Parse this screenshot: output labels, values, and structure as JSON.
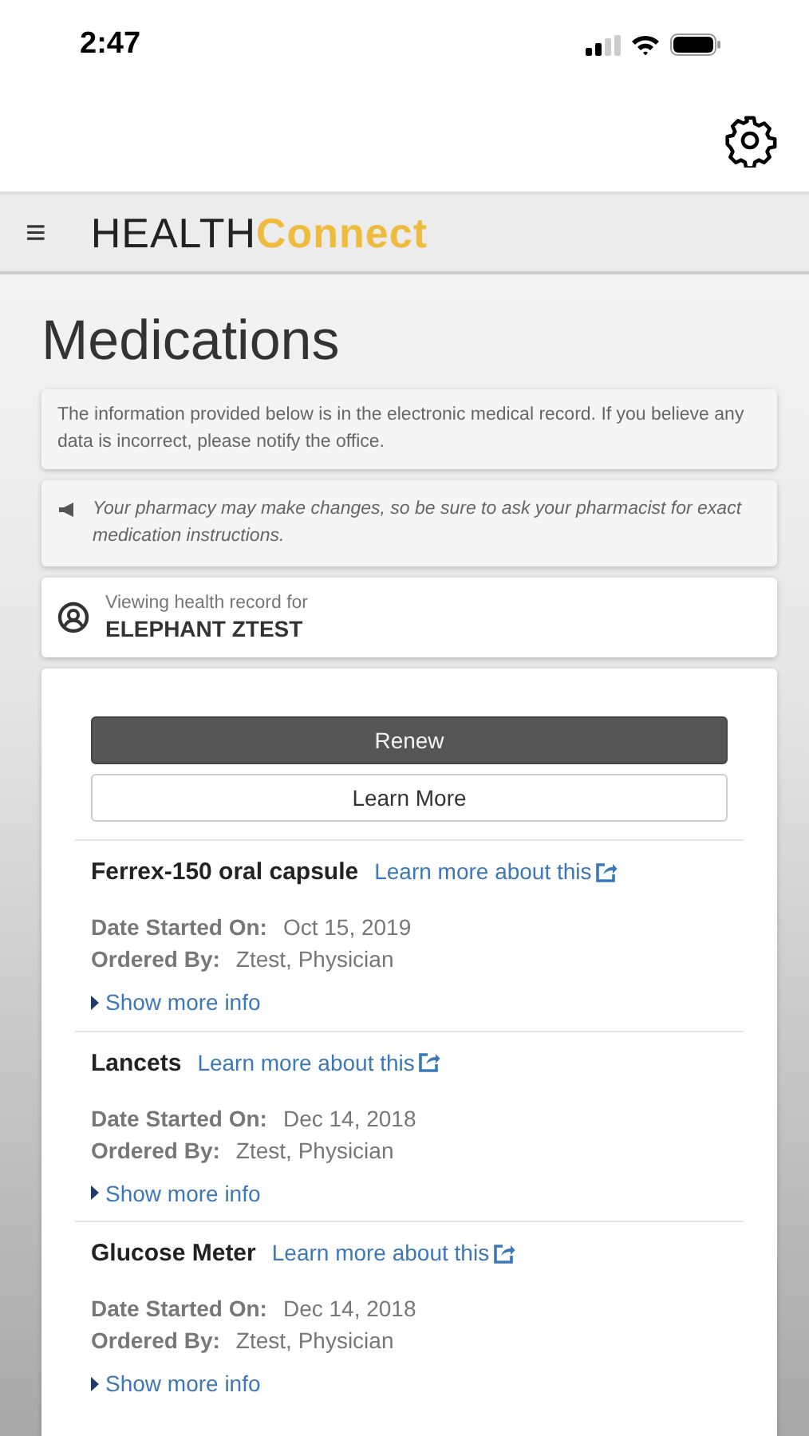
{
  "status_bar": {
    "time": "2:47"
  },
  "header": {
    "menu_glyph": "≡",
    "logo_dark": "HEALTH",
    "logo_accent": "Connect"
  },
  "page": {
    "title": "Medications",
    "notice": "The information provided below is in the electronic medical record. If you believe any data is incorrect, please notify the office.",
    "pharmacy_note": "Your pharmacy may make changes, so be sure to ask your pharmacist for exact medication instructions.",
    "record_label": "Viewing health record for",
    "patient_name": "ELEPHANT ZTEST"
  },
  "buttons": [
    {
      "label": "Renew",
      "kind": "primary"
    },
    {
      "label": "Learn More",
      "kind": "secondary"
    }
  ],
  "medications": [
    {
      "name": "Ferrex-150 oral capsule",
      "link": "Learn more about this",
      "fields": [
        {
          "label": "Date Started On:",
          "value": "Oct 15, 2019"
        },
        {
          "label": "Ordered By:",
          "value": "Ztest, Physician"
        }
      ],
      "more": "Show more info"
    },
    {
      "name": "Lancets",
      "link": "Learn more about this",
      "fields": [
        {
          "label": "Date Started On:",
          "value": "Dec 14, 2018"
        },
        {
          "label": "Ordered By:",
          "value": "Ztest, Physician"
        }
      ],
      "more": "Show more info"
    },
    {
      "name": "Glucose Meter",
      "link": "Learn more about this",
      "fields": [
        {
          "label": "Date Started On:",
          "value": "Dec 14, 2018"
        },
        {
          "label": "Ordered By:",
          "value": "Ztest, Physician"
        }
      ],
      "more": "Show more info"
    }
  ]
}
